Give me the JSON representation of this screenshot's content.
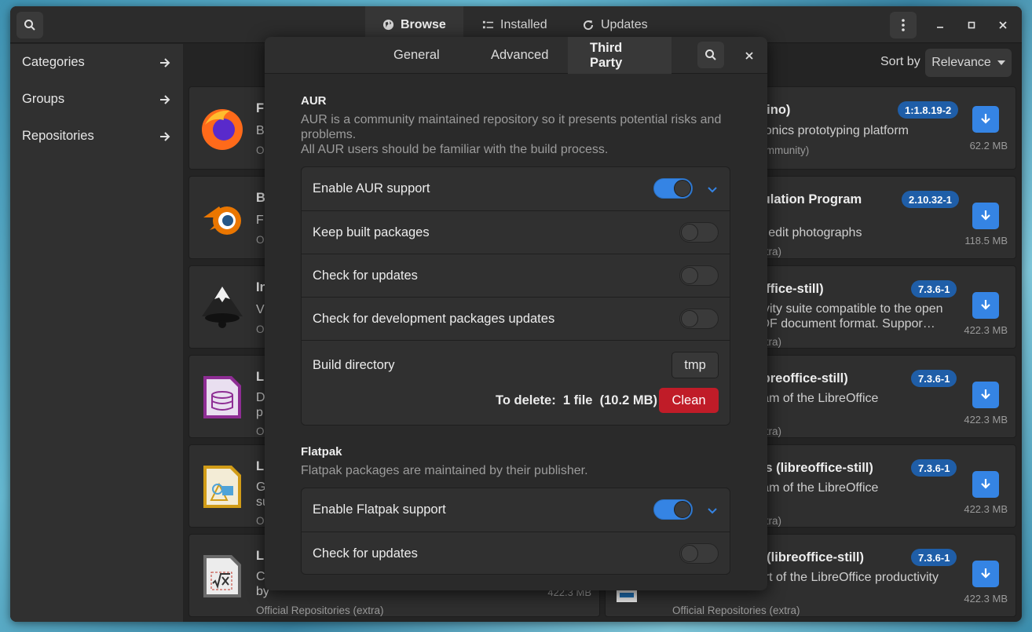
{
  "header": {
    "tabs": [
      {
        "label": "Browse",
        "icon": "globe-icon"
      },
      {
        "label": "Installed",
        "icon": "list-icon"
      },
      {
        "label": "Updates",
        "icon": "refresh-icon"
      }
    ]
  },
  "sidebar": {
    "items": [
      {
        "label": "Categories"
      },
      {
        "label": "Groups"
      },
      {
        "label": "Repositories"
      }
    ]
  },
  "sort": {
    "label": "Sort by",
    "value": "Relevance"
  },
  "left_cards": [
    {
      "title": "F",
      "desc": "B",
      "repo": "O",
      "icon": "firefox-icon"
    },
    {
      "title": "B",
      "desc": "F",
      "repo": "O",
      "icon": "blender-icon"
    },
    {
      "title": "In",
      "desc": "V",
      "repo": "O",
      "icon": "inkscape-icon"
    },
    {
      "title": "L",
      "desc": "D",
      "desc2": "p",
      "repo": "O",
      "icon": "libreoffice-base-icon"
    },
    {
      "title": "L",
      "desc": "G",
      "desc2": "su",
      "repo": "O",
      "icon": "libreoffice-draw-icon"
    },
    {
      "title": "L",
      "desc": "C",
      "desc2": "by",
      "repo": "Official Repositories (extra)",
      "size": "422.3 MB",
      "icon": "libreoffice-math-icon"
    }
  ],
  "right_cards": [
    {
      "title": "duino)",
      "desc": "ctronics prototyping platform",
      "repo": "(community)",
      "version": "1:1.8.19-2",
      "size": "62.2 MB"
    },
    {
      "title": "ipulation Program",
      "desc": "nd edit photographs",
      "repo": "(extra)",
      "version": "2.10.32-1",
      "size": "118.5 MB"
    },
    {
      "title": "eoffice-still)",
      "desc": "ctivity suite compatible to the open",
      "desc2": "ODF document format. Suppor…",
      "repo": "(extra)",
      "version": "7.3.6-1",
      "size": "422.3 MB"
    },
    {
      "title": "(libreoffice-still)",
      "desc": "gram of the LibreOffice",
      "repo": "(extra)",
      "version": "7.3.6-1",
      "size": "422.3 MB"
    },
    {
      "title": "ess (libreoffice-still)",
      "desc": "gram of the LibreOffice",
      "repo": "(extra)",
      "version": "7.3.6-1",
      "size": "422.3 MB"
    },
    {
      "title": "er (libreoffice-still)",
      "desc": "part of the LibreOffice productivity",
      "repo": "Official Repositories (extra)",
      "version": "7.3.6-1",
      "size": "422.3 MB"
    }
  ],
  "dialog": {
    "tabs": [
      {
        "label": "General"
      },
      {
        "label": "Advanced"
      },
      {
        "label": "Third Party"
      }
    ],
    "aur": {
      "title": "AUR",
      "desc1": "AUR is a community maintained repository so it presents potential risks and problems.",
      "desc2": "All AUR users should be familiar with the build process.",
      "enable_label": "Enable AUR support",
      "enable_on": true,
      "keep_label": "Keep built packages",
      "keep_on": false,
      "check_label": "Check for updates",
      "check_on": false,
      "dev_label": "Check for development packages updates",
      "dev_on": false,
      "build_dir_label": "Build directory",
      "build_dir_value": "tmp",
      "to_delete": "To delete:  1 file  (10.2 MB)",
      "clean_label": "Clean"
    },
    "flatpak": {
      "title": "Flatpak",
      "desc": "Flatpak packages are maintained by their publisher.",
      "enable_label": "Enable Flatpak support",
      "enable_on": true,
      "check_label": "Check for updates",
      "check_on": false
    }
  },
  "colors": {
    "accent": "#3584e4",
    "destructive": "#c01c28",
    "badge": "#1f5ea8"
  }
}
